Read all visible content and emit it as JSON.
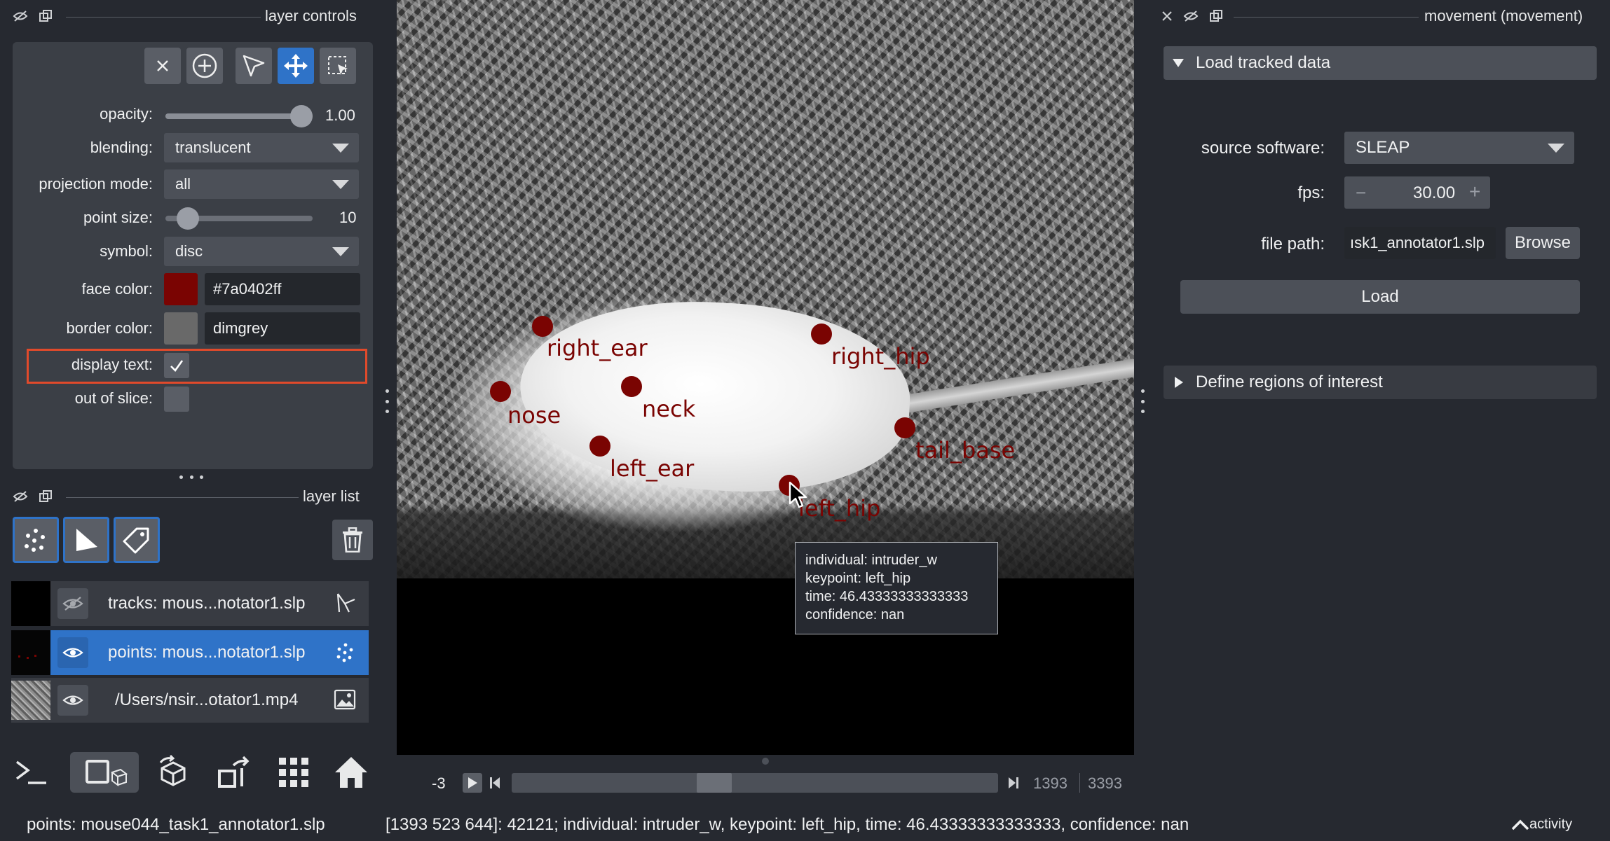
{
  "layer_controls": {
    "title": "layer controls",
    "opacity_label": "opacity:",
    "opacity_value": "1.00",
    "opacity_fraction": 1.0,
    "blending_label": "blending:",
    "blending_value": "translucent",
    "projection_label": "projection mode:",
    "projection_value": "all",
    "point_size_label": "point size:",
    "point_size_value": "10",
    "symbol_label": "symbol:",
    "symbol_value": "disc",
    "face_color_label": "face color:",
    "face_color_value": "#7a0402ff",
    "face_color_swatch": "#7a0402",
    "border_color_label": "border color:",
    "border_color_value": "dimgrey",
    "border_color_swatch": "#696969",
    "display_text_label": "display text:",
    "display_text_checked": true,
    "out_of_slice_label": "out of slice:",
    "out_of_slice_checked": false
  },
  "layer_list": {
    "title": "layer list",
    "layers": [
      {
        "name": "tracks: mous...notator1.slp",
        "visible": false,
        "selected": false,
        "type_icon": "tracks-icon"
      },
      {
        "name": "points: mous...notator1.slp",
        "visible": true,
        "selected": true,
        "type_icon": "points-icon"
      },
      {
        "name": "/Users/nsir...otator1.mp4",
        "visible": true,
        "selected": false,
        "type_icon": "image-icon"
      }
    ]
  },
  "viewer": {
    "keypoints": [
      {
        "label": "right_ear"
      },
      {
        "label": "nose"
      },
      {
        "label": "neck"
      },
      {
        "label": "left_ear"
      },
      {
        "label": "right_hip"
      },
      {
        "label": "tail_base"
      },
      {
        "label": "left_hip"
      }
    ],
    "tooltip": {
      "line1": "individual: intruder_w",
      "line2": "keypoint: left_hip",
      "line3": "time: 46.43333333333333",
      "line4": "confidence: nan"
    },
    "dims_slider": {
      "frame_label": "-3",
      "current": "1393",
      "total": "3393"
    }
  },
  "movement_panel": {
    "title": "movement (movement)",
    "section1_title": "Load tracked data",
    "source_software_label": "source software:",
    "source_software_value": "SLEAP",
    "fps_label": "fps:",
    "fps_value": "30.00",
    "fps_minus": "−",
    "fps_plus": "+",
    "file_path_label": "file path:",
    "file_path_value": "ısk1_annotator1.slp",
    "browse_label": "Browse",
    "load_label": "Load",
    "section2_title": "Define regions of interest"
  },
  "status_bar": {
    "layer": "points: mouse044_task1_annotator1.slp",
    "info": "[1393 523 644]: 42121; individual: intruder_w, keypoint: left_hip, time: 46.43333333333333, confidence: nan",
    "activity": "activity"
  },
  "colors": {
    "keypoint": "#7a0402",
    "accent_blue": "#2f73c8",
    "highlight_red": "#e14a2b"
  }
}
